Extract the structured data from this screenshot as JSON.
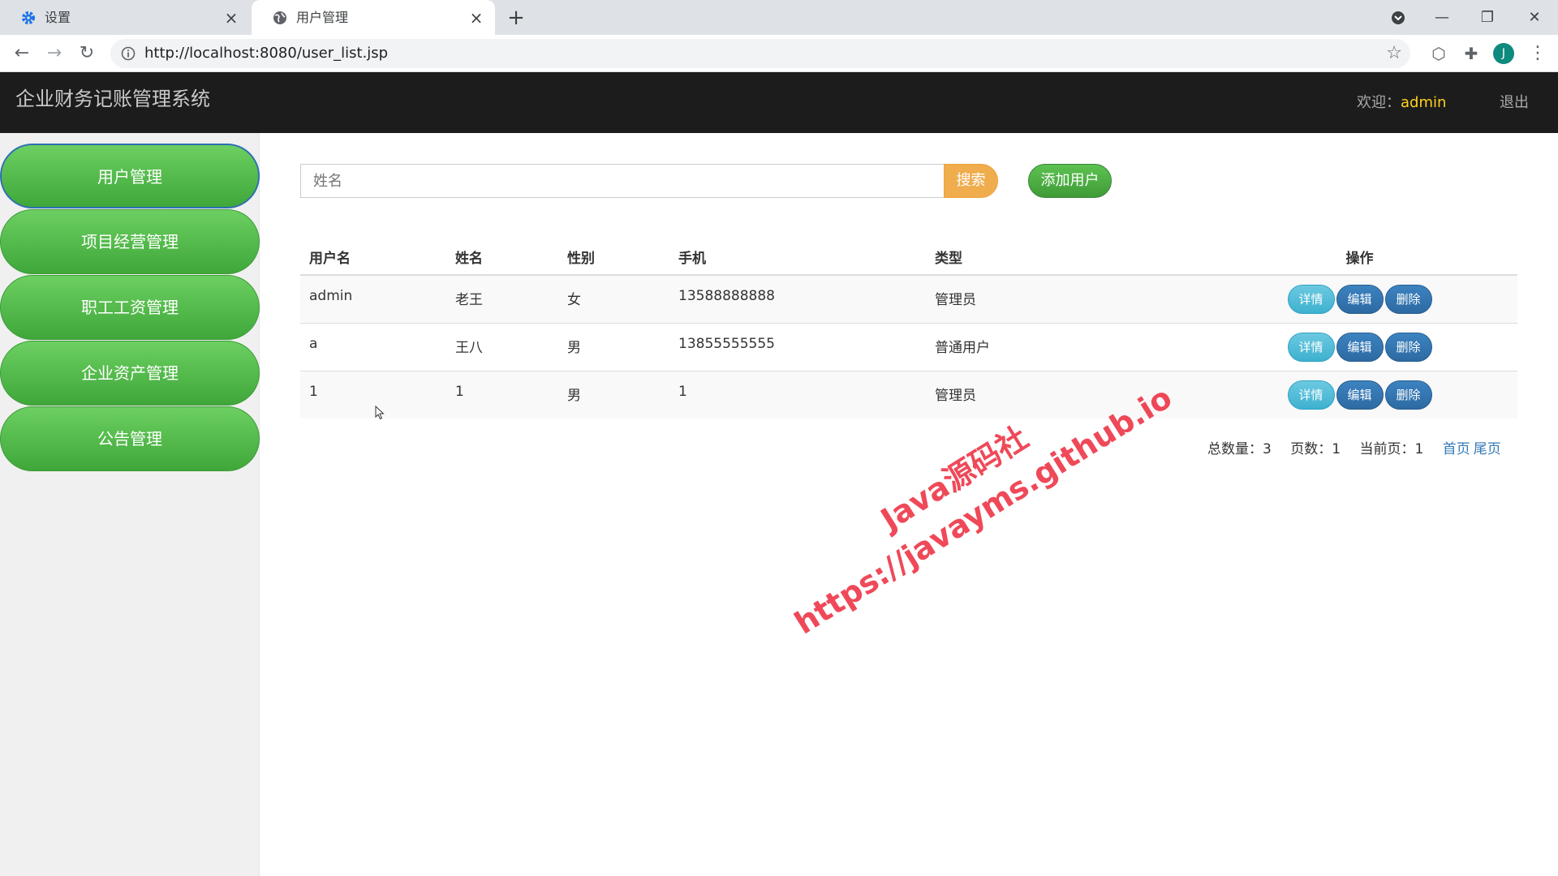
{
  "browser": {
    "tabs": [
      {
        "title": "设置",
        "icon": "gear-icon"
      },
      {
        "title": "用户管理",
        "icon": "globe-icon"
      }
    ],
    "url": "http://localhost:8080/user_list.jsp",
    "avatar_letter": "J"
  },
  "header": {
    "title": "企业财务记账管理系统",
    "welcome_label": "欢迎：",
    "username": "admin",
    "logout_label": "退出"
  },
  "sidebar": {
    "items": [
      {
        "label": "用户管理"
      },
      {
        "label": "项目经营管理"
      },
      {
        "label": "职工工资管理"
      },
      {
        "label": "企业资产管理"
      },
      {
        "label": "公告管理"
      }
    ]
  },
  "search": {
    "placeholder": "姓名",
    "button_label": "搜索"
  },
  "add_user_label": "添加用户",
  "table": {
    "headers": {
      "username": "用户名",
      "name": "姓名",
      "gender": "性别",
      "phone": "手机",
      "type": "类型",
      "ops": "操作"
    },
    "rows": [
      {
        "username": "admin",
        "name": "老王",
        "gender": "女",
        "phone": "13588888888",
        "type": "管理员"
      },
      {
        "username": "a",
        "name": "王八",
        "gender": "男",
        "phone": "13855555555",
        "type": "普通用户"
      },
      {
        "username": "1",
        "name": "1",
        "gender": "男",
        "phone": "1",
        "type": "管理员"
      }
    ],
    "op_labels": {
      "detail": "详情",
      "edit": "编辑",
      "delete": "删除"
    }
  },
  "pagination": {
    "total": "总数量：3",
    "pages": "页数：1",
    "current": "当前页：1",
    "first": "首页",
    "last": "尾页"
  },
  "watermark": {
    "line1": "Java源码社",
    "line2": "https://javayms.github.io"
  },
  "colors": {
    "header_bg": "#1c1c1c",
    "sidebar_green": "#4cb944",
    "search_orange": "#f0ad4e",
    "detail_blue": "#5bc0de",
    "edit_blue": "#337ab7",
    "username_yellow": "#ffd21f",
    "watermark_red": "#ee3a4b"
  }
}
